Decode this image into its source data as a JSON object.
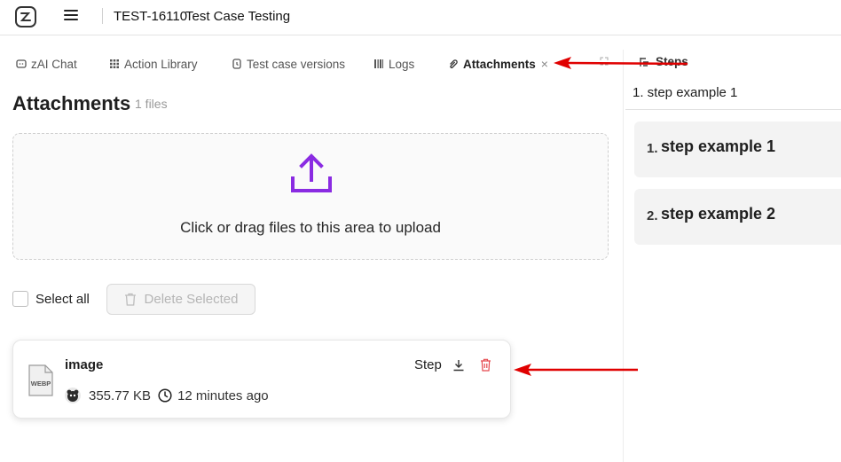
{
  "header": {
    "test_case_id": "TEST-16110",
    "test_case_name": "Test Case Testing"
  },
  "tabs": [
    {
      "label": "zAI Chat",
      "icon": "chat-icon"
    },
    {
      "label": "Action Library",
      "icon": "grid-icon"
    },
    {
      "label": "Test case versions",
      "icon": "versions-icon"
    },
    {
      "label": "Logs",
      "icon": "logs-icon"
    },
    {
      "label": "Attachments",
      "icon": "attachment-icon",
      "active": true
    }
  ],
  "attachments": {
    "title": "Attachments",
    "count_label": "1 files",
    "upload_text": "Click or drag files to this area to upload",
    "select_all_label": "Select all",
    "delete_selected_label": "Delete Selected",
    "files": [
      {
        "name": "image",
        "type_label": "WEBP",
        "size": "355.77 KB",
        "time": "12 minutes ago",
        "step_label": "Step"
      }
    ]
  },
  "right_panel": {
    "tab_label": "Steps",
    "selected_step": "1. step example 1",
    "steps": [
      {
        "number": "1.",
        "text": "step example 1"
      },
      {
        "number": "2.",
        "text": "step example 2"
      }
    ]
  },
  "colors": {
    "accent": "#7c3aed",
    "annotation_arrow": "#e00000",
    "delete_red": "#e5484d"
  }
}
